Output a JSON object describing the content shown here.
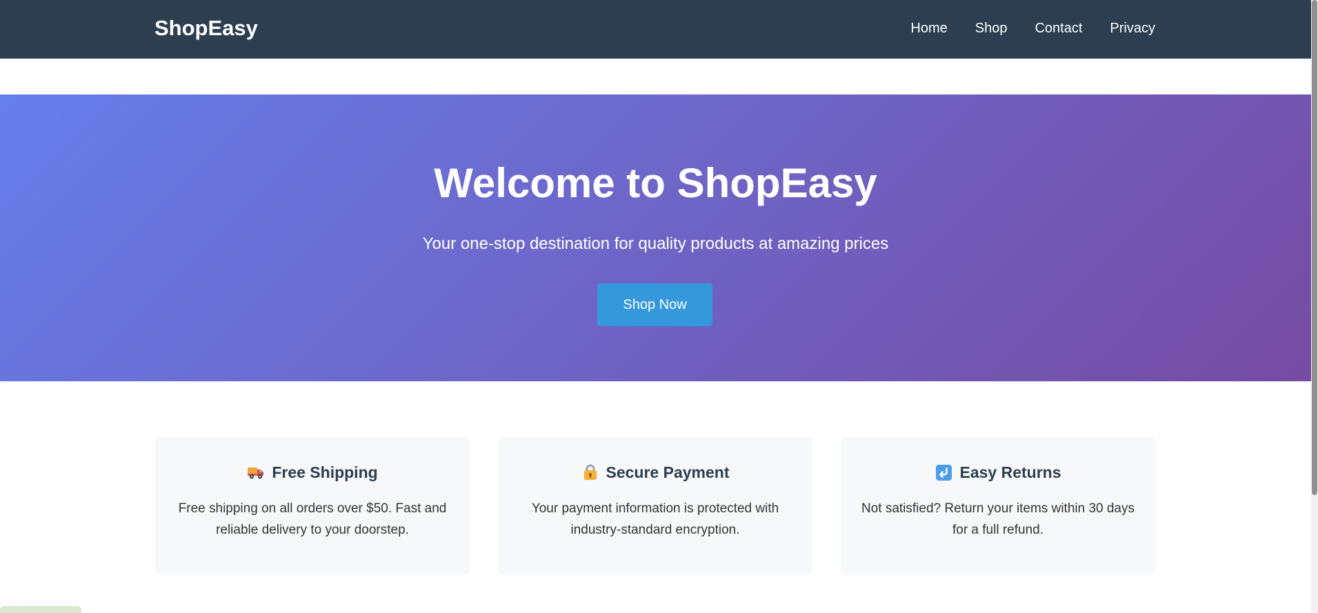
{
  "navbar": {
    "brand": "ShopEasy",
    "links": [
      "Home",
      "Shop",
      "Contact",
      "Privacy"
    ]
  },
  "hero": {
    "title": "Welcome to ShopEasy",
    "subtitle": "Your one-stop destination for quality products at amazing prices",
    "button_label": "Shop Now"
  },
  "features": [
    {
      "title": "Free Shipping",
      "description": "Free shipping on all orders over $50. Fast and reliable delivery to your doorstep.",
      "icon": "truck-icon"
    },
    {
      "title": "Secure Payment",
      "description": "Your payment information is protected with industry-standard encryption.",
      "icon": "lock-icon"
    },
    {
      "title": "Easy Returns",
      "description": "Not satisfied? Return your items within 30 days for a full refund.",
      "icon": "return-arrow-icon"
    }
  ],
  "colors": {
    "navbar": "#2c3e50",
    "hero_gradient_start": "#667eea",
    "hero_gradient_end": "#764ba2",
    "button": "#3498db",
    "card": "#f7f8fa"
  }
}
